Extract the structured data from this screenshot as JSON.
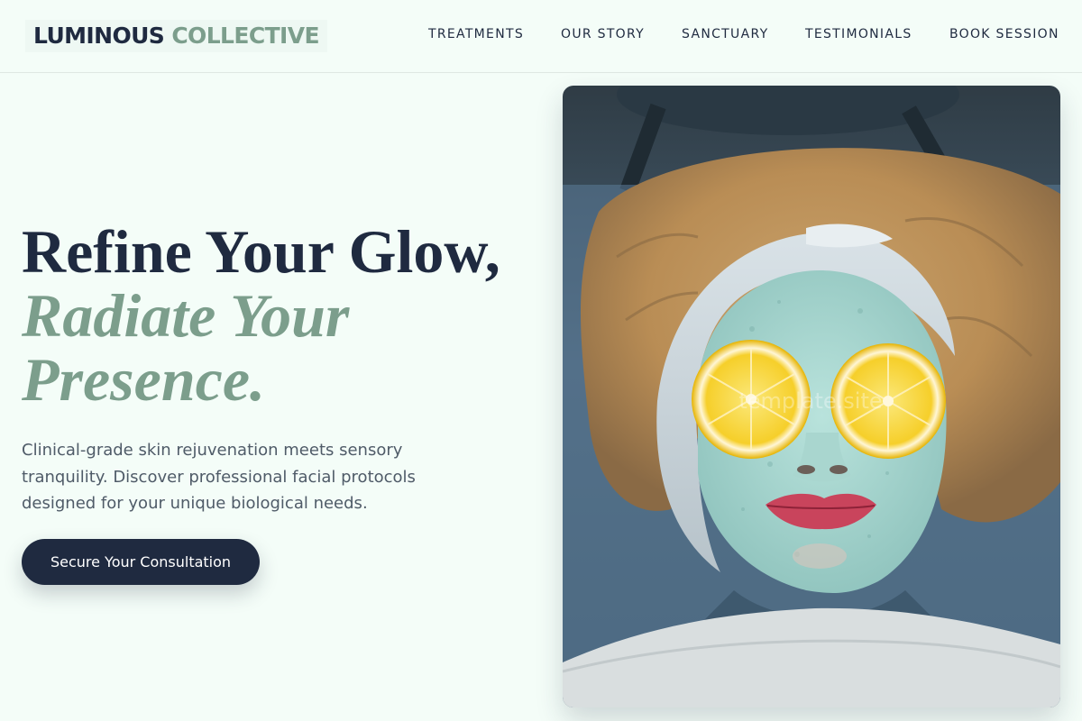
{
  "brand": {
    "name_part1": "LUMINOUS",
    "name_part2": "COLLECTIVE"
  },
  "nav": {
    "items": [
      {
        "label": "TREATMENTS"
      },
      {
        "label": "OUR STORY"
      },
      {
        "label": "SANCTUARY"
      },
      {
        "label": "TESTIMONIALS"
      },
      {
        "label": "BOOK SESSION"
      }
    ]
  },
  "hero": {
    "title_line1": "Refine Your Glow,",
    "title_line2": "Radiate Your",
    "title_line3": "Presence.",
    "description": "Clinical-grade skin rejuvenation meets sensory tranquility. Discover professional facial protocols designed for your unique biological needs.",
    "cta_label": "Secure Your Consultation",
    "image_watermark": "template.site"
  },
  "colors": {
    "background": "#f4fdf8",
    "navy": "#1f2a40",
    "sage": "#7c9e8c",
    "body_text": "#4f5b68"
  }
}
